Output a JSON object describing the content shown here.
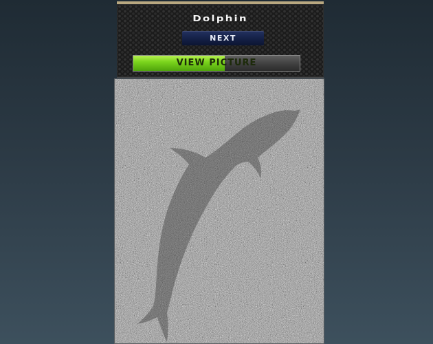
{
  "puzzle": {
    "title": "Dolphin",
    "next_label": "NEXT",
    "view_picture_label": "VIEW PICTURE",
    "reveal_progress": 0.55
  },
  "picture": {
    "subject_icon": "dolphin-silhouette",
    "noise_color": "#8d8d8d"
  },
  "colors": {
    "frame_trim": "#b9a880",
    "next_button": "#142046",
    "progress_green": "#7bd51d"
  }
}
